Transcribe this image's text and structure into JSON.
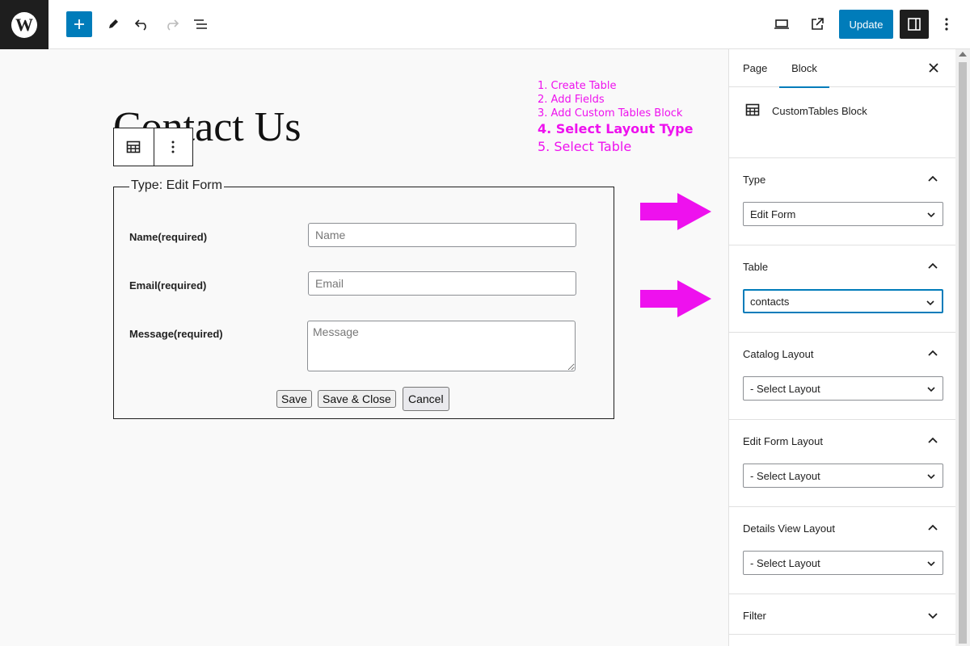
{
  "topbar": {
    "logo_glyph": "W",
    "update_label": "Update"
  },
  "page": {
    "title": "Contact Us"
  },
  "steps": [
    "1. Create Table",
    "2. Add Fields",
    "3. Add Custom Tables Block",
    "4. Select Layout Type",
    "5. Select Table"
  ],
  "form": {
    "legend": "Type: Edit Form",
    "fields": [
      {
        "label": "Name(required)",
        "placeholder": "Name"
      },
      {
        "label": "Email(required)",
        "placeholder": "Email"
      },
      {
        "label": "Message(required)",
        "placeholder": "Message"
      }
    ],
    "buttons": {
      "save": "Save",
      "save_close": "Save & Close",
      "cancel": "Cancel"
    }
  },
  "sidebar": {
    "tabs": {
      "page": "Page",
      "block": "Block"
    },
    "block_name": "CustomTables Block",
    "panels": [
      {
        "title": "Type",
        "value": "Edit Form"
      },
      {
        "title": "Table",
        "value": "contacts"
      },
      {
        "title": "Catalog Layout",
        "value": "- Select Layout"
      },
      {
        "title": "Edit Form Layout",
        "value": "- Select Layout"
      },
      {
        "title": "Details View Layout",
        "value": "- Select Layout"
      },
      {
        "title": "Filter"
      }
    ]
  },
  "colors": {
    "accent": "#007cba",
    "annotation": "#ee11ee",
    "dark": "#1e1e1e"
  }
}
